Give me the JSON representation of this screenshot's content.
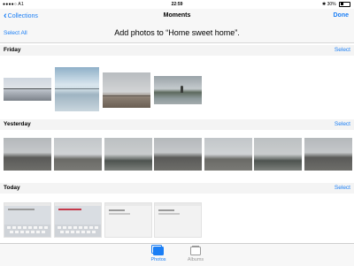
{
  "status_bar": {
    "carrier": "●●●●○ A1",
    "time": "22:59",
    "battery": "30%"
  },
  "nav": {
    "back_label": "Collections",
    "title": "Moments",
    "done_label": "Done"
  },
  "toolbar": {
    "select_all": "Select All",
    "prompt": "Add photos to “Home sweet home”."
  },
  "sections": [
    {
      "title": "Friday",
      "select_label": "Select",
      "photo_count": 4
    },
    {
      "title": "Yesterday",
      "select_label": "Select",
      "photo_count": 7
    },
    {
      "title": "Today",
      "select_label": "Select",
      "photo_count": 4
    }
  ],
  "tabs": [
    {
      "label": "Photos",
      "icon": "photos-icon",
      "active": true
    },
    {
      "label": "Albums",
      "icon": "albums-icon",
      "active": false
    }
  ],
  "colors": {
    "accent": "#1a7ef5",
    "bar": "#f7f7f7"
  }
}
